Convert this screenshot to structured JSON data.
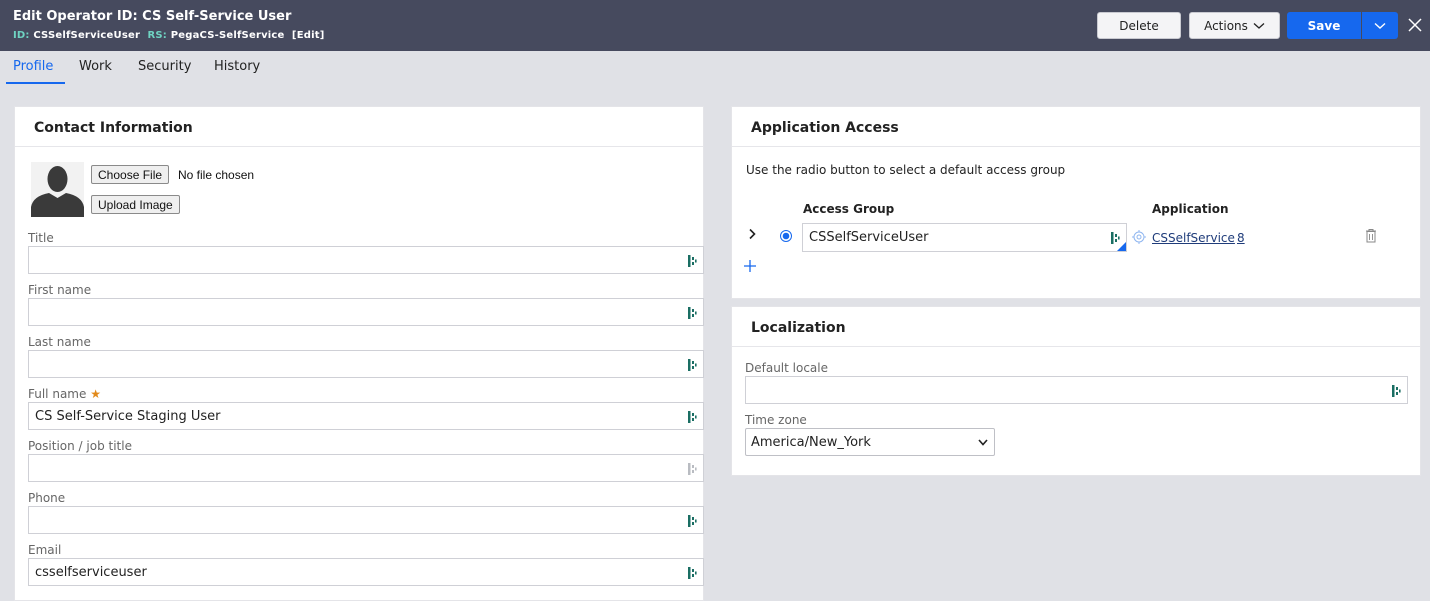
{
  "header": {
    "title": "Edit  Operator ID: CS Self-Service User",
    "id_label": "ID:",
    "id_value": "CSSelfServiceUser",
    "rs_label": "RS:",
    "rs_value": "PegaCS-SelfService",
    "edit_link": "[Edit]",
    "delete_label": "Delete",
    "actions_label": "Actions",
    "save_label": "Save"
  },
  "tabs": [
    {
      "label": "Profile",
      "active": true
    },
    {
      "label": "Work"
    },
    {
      "label": "Security"
    },
    {
      "label": "History"
    }
  ],
  "contact": {
    "title": "Contact Information",
    "choose_file": "Choose File",
    "no_file": "No file chosen",
    "upload": "Upload Image",
    "fields": [
      {
        "label": "Title",
        "value": ""
      },
      {
        "label": "First name",
        "value": ""
      },
      {
        "label": "Last name",
        "value": ""
      },
      {
        "label": "Full name",
        "value": "CS Self-Service Staging User",
        "required": true
      },
      {
        "label": "Position / job title",
        "value": ""
      },
      {
        "label": "Phone",
        "value": ""
      },
      {
        "label": "Email",
        "value": "csselfserviceuser"
      }
    ]
  },
  "app_access": {
    "title": "Application Access",
    "instruction": "Use the radio button to select a default access group",
    "col_access_group": "Access Group",
    "col_application": "Application",
    "rows": [
      {
        "access_group": "CSSelfServiceUser",
        "application": "CSSelfService",
        "version": "8",
        "default": true
      }
    ]
  },
  "localization": {
    "title": "Localization",
    "default_locale_label": "Default locale",
    "default_locale_value": "",
    "time_zone_label": "Time zone",
    "time_zone_value": "America/New_York"
  },
  "colors": {
    "header_bg": "#464a5e",
    "accent": "#1668ee",
    "key_green": "#6fd3c2",
    "required": "#e28a1a"
  }
}
